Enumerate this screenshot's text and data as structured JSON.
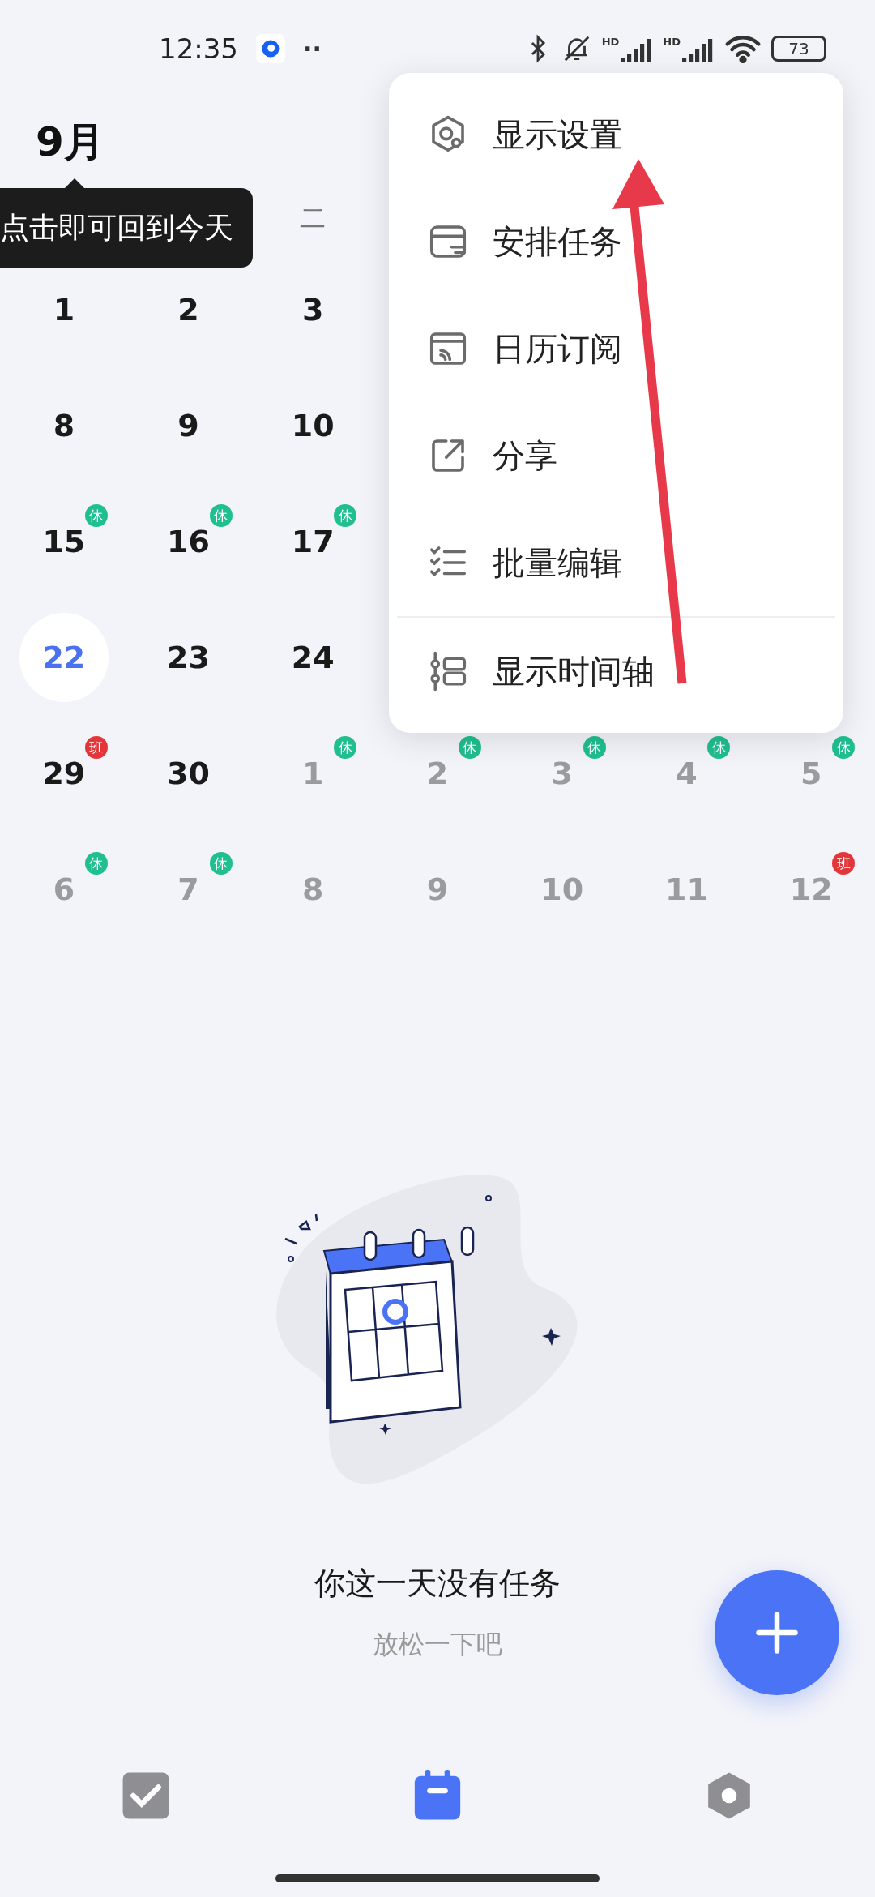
{
  "status_bar": {
    "time": "12:35",
    "dots": "··",
    "hd_labels": [
      "HD",
      "HD"
    ],
    "battery": "73"
  },
  "header": {
    "month": "9月"
  },
  "tooltip": {
    "text": "点击即可回到今天"
  },
  "weekday_header": {
    "label": "二"
  },
  "weeks": [
    [
      {
        "day": "1",
        "muted": false
      },
      {
        "day": "2",
        "muted": false
      },
      {
        "day": "3",
        "muted": false
      }
    ],
    [
      {
        "day": "8",
        "muted": false
      },
      {
        "day": "9",
        "muted": false
      },
      {
        "day": "10",
        "muted": false
      }
    ],
    [
      {
        "day": "15",
        "muted": false,
        "badge": {
          "text": "休",
          "kind": "rest"
        }
      },
      {
        "day": "16",
        "muted": false,
        "badge": {
          "text": "休",
          "kind": "rest"
        }
      },
      {
        "day": "17",
        "muted": false,
        "badge": {
          "text": "休",
          "kind": "rest"
        }
      }
    ],
    [
      {
        "day": "22",
        "muted": false,
        "today": true
      },
      {
        "day": "23",
        "muted": false
      },
      {
        "day": "24",
        "muted": false
      }
    ],
    [
      {
        "day": "29",
        "muted": false,
        "badge": {
          "text": "班",
          "kind": "work"
        }
      },
      {
        "day": "30",
        "muted": false
      },
      {
        "day": "1",
        "muted": true,
        "badge": {
          "text": "休",
          "kind": "rest"
        }
      },
      {
        "day": "2",
        "muted": true,
        "badge": {
          "text": "休",
          "kind": "rest"
        }
      },
      {
        "day": "3",
        "muted": true,
        "badge": {
          "text": "休",
          "kind": "rest"
        }
      },
      {
        "day": "4",
        "muted": true,
        "badge": {
          "text": "休",
          "kind": "rest"
        }
      },
      {
        "day": "5",
        "muted": true,
        "badge": {
          "text": "休",
          "kind": "rest"
        }
      }
    ],
    [
      {
        "day": "6",
        "muted": true,
        "badge": {
          "text": "休",
          "kind": "rest"
        }
      },
      {
        "day": "7",
        "muted": true,
        "badge": {
          "text": "休",
          "kind": "rest"
        }
      },
      {
        "day": "8",
        "muted": true
      },
      {
        "day": "9",
        "muted": true
      },
      {
        "day": "10",
        "muted": true
      },
      {
        "day": "11",
        "muted": true
      },
      {
        "day": "12",
        "muted": true,
        "badge": {
          "text": "班",
          "kind": "work"
        }
      }
    ]
  ],
  "menu": {
    "items": [
      {
        "label": "显示设置",
        "kind": "display"
      },
      {
        "label": "安排任务",
        "kind": "schedule"
      },
      {
        "label": "日历订阅",
        "kind": "subscribe"
      },
      {
        "label": "分享",
        "kind": "share"
      },
      {
        "label": "批量编辑",
        "kind": "batch"
      },
      {
        "label": "显示时间轴",
        "kind": "timeline",
        "divider_before": true
      }
    ]
  },
  "empty_state": {
    "title": "你这一天没有任务",
    "subtitle": "放松一下吧"
  },
  "bottom_nav": [
    {
      "kind": "tasks",
      "selected": false
    },
    {
      "kind": "calendar",
      "selected": true
    },
    {
      "kind": "settings",
      "selected": false
    }
  ]
}
